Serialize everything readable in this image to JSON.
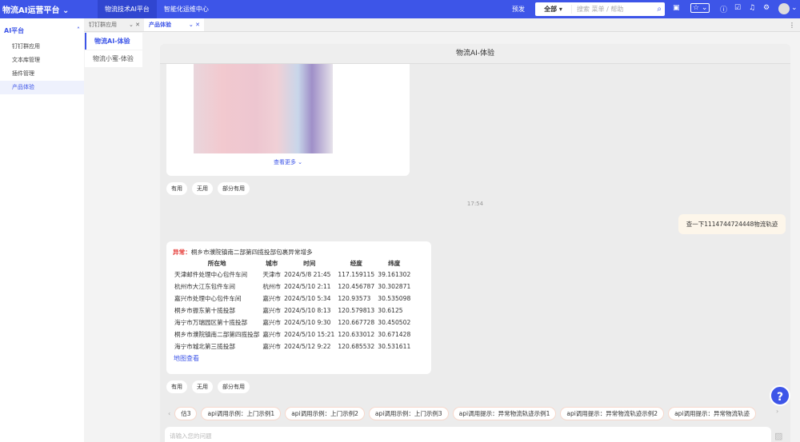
{
  "header": {
    "brand": "物流AI运营平台",
    "nav": [
      "物流技术AI平台",
      "智能化运维中心"
    ],
    "env": "预发",
    "search_scope": "全部",
    "search_placeholder": "搜索 菜单 / 帮助"
  },
  "sidebar": {
    "group": "AI平台",
    "items": [
      "钉钉群应用",
      "文本库管理",
      "插件管理",
      "产品体验"
    ]
  },
  "tabs": [
    "钉钉群应用",
    "产品体验"
  ],
  "subnav": [
    "物流AI-体验",
    "物流小蜜-体验"
  ],
  "chat": {
    "title": "物流AI-体验",
    "see_more": "查看更多",
    "feedback": [
      "有用",
      "无用",
      "部分有用"
    ],
    "time": "17:54",
    "user_msg": "查一下1114744724448物流轨迹",
    "answer": {
      "label": "异常：",
      "text": "桐乡市濮院镇南二部第四揽投部包裹异常增多",
      "columns": [
        "所在地",
        "城市",
        "时间",
        "经度",
        "纬度"
      ],
      "rows": [
        [
          "天津邮件处理中心包件车间",
          "天津市",
          "2024/5/8 21:45",
          "117.159115",
          "39.161302"
        ],
        [
          "杭州市大江东包件车间",
          "杭州市",
          "2024/5/10 2:11",
          "120.456787",
          "30.302871"
        ],
        [
          "嘉兴市处理中心包件车间",
          "嘉兴市",
          "2024/5/10 5:34",
          "120.93573",
          "30.535098"
        ],
        [
          "桐乡市振东第十揽投部",
          "嘉兴市",
          "2024/5/10 8:13",
          "120.579813",
          "30.6125"
        ],
        [
          "海宁市万瑞园区第十揽投部",
          "嘉兴市",
          "2024/5/10 9:30",
          "120.667728",
          "30.450502"
        ],
        [
          "桐乡市濮院镇南二部第四揽投部",
          "嘉兴市",
          "2024/5/10 15:21",
          "120.633012",
          "30.671428"
        ],
        [
          "海宁市城北第三揽投部",
          "嘉兴市",
          "2024/5/12 9:22",
          "120.685532",
          "30.531611"
        ]
      ],
      "map_link": "地图查看"
    },
    "chips": [
      "估3",
      "api调用示例：上门示例1",
      "api调用示例：上门示例2",
      "api调用示例：上门示例3",
      "api调用提示：异常物流轨迹示例1",
      "api调用提示：异常物流轨迹示例2",
      "api调用提示：异常物流轨迹"
    ],
    "input_placeholder": "请输入您的问题"
  },
  "colors": {
    "primary": "#3d55e8",
    "alert": "#e53935"
  }
}
